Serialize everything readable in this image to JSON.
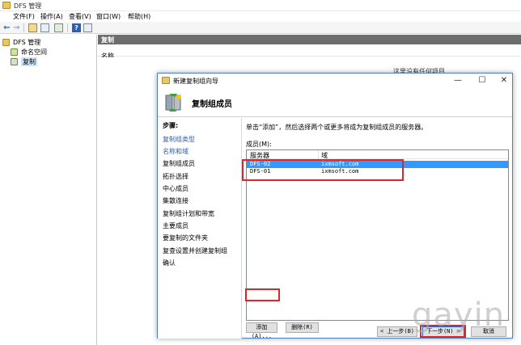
{
  "app": {
    "title": "DFS 管理",
    "icon": "dfs-app-icon"
  },
  "menu": [
    "文件(F)",
    "操作(A)",
    "查看(V)",
    "窗口(W)",
    "帮助(H)"
  ],
  "toolbar": {
    "icons": [
      "back-arrow-icon",
      "forward-arrow-icon",
      "up-folder-icon",
      "show-hide-tree-icon",
      "export-icon",
      "help-icon",
      "properties-icon"
    ]
  },
  "tree": {
    "root": "DFS 管理",
    "items": [
      "命名空间",
      "复制"
    ]
  },
  "right_pane": {
    "header": "复制",
    "column": "名称",
    "hidden_text": "这里没有任何项目"
  },
  "wizard": {
    "title": "新建复制组向导",
    "header": "复制组成员",
    "steps_title": "步骤:",
    "steps": [
      "复制组类型",
      "名称和域",
      "复制组成员",
      "拓扑选择",
      "中心成员",
      "集散连接",
      "复制组计划和带宽",
      "主要成员",
      "要复制的文件夹",
      "复查设置并创建复制组",
      "确认"
    ],
    "instruction": "单击“添加”，然后选择两个或更多将成为复制组成员的服务器。",
    "members_label": "成员(M):",
    "columns": [
      "服务器",
      "域"
    ],
    "rows": [
      {
        "server": "DFS-02",
        "domain": "ixmsoft.com",
        "selected": true
      },
      {
        "server": "DFS-01",
        "domain": "ixmsoft.com",
        "selected": false
      }
    ],
    "buttons": {
      "add": "添加(A)...",
      "delete": "删除(R)",
      "back": "< 上一步(B)",
      "next": "下一步(N) >",
      "cancel": "取消"
    }
  },
  "watermark": "gayin"
}
